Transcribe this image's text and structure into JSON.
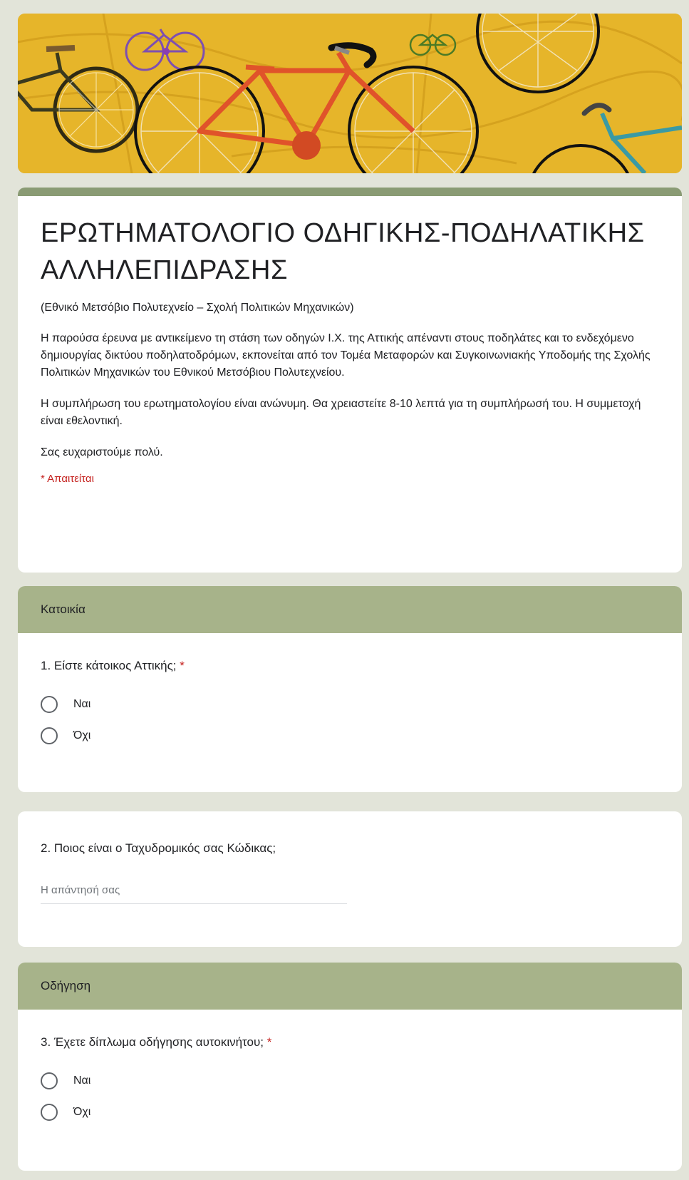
{
  "form": {
    "title": "ΕΡΩΤΗΜΑΤΟΛΟΓΙΟ ΟΔΗΓΙΚΗΣ-ΠΟΔΗΛΑΤΙΚΗΣ ΑΛΛΗΛΕΠΙΔΡΑΣΗΣ",
    "subtitle": "(Εθνικό Μετσόβιο Πολυτεχνείο – Σχολή Πολιτικών Μηχανικών)",
    "paragraph_1": "Η παρούσα έρευνα με αντικείμενο τη στάση των οδηγών Ι.Χ. της Αττικής απέναντι στους ποδηλάτες και το ενδεχόμενο δημιουργίας δικτύου ποδηλατοδρόμων, εκπονείται από τον Τομέα Μεταφορών και Συγκοινωνιακής Υποδομής της Σχολής Πολιτικών Μηχανικών του Εθνικού Μετσόβιου Πολυτεχνείου.",
    "paragraph_2": "Η συμπλήρωση του ερωτηματολογίου είναι ανώνυμη. Θα χρειαστείτε 8-10 λεπτά για τη συμπλήρωσή του. Η συμμετοχή είναι εθελοντική.",
    "paragraph_3": "Σας ευχαριστούμε πολύ.",
    "required_note": "* Απαιτείται"
  },
  "sections": [
    {
      "header": "Κατοικία",
      "question": {
        "text": "1. Είστε κάτοικος Αττικής;",
        "required_mark": "*",
        "options": [
          "Ναι",
          "Όχι"
        ]
      }
    },
    {
      "header": "Οδήγηση",
      "question": {
        "text": "3. Έχετε δίπλωμα οδήγησης αυτοκινήτου;",
        "required_mark": "*",
        "options": [
          "Ναι",
          "Όχι"
        ]
      }
    }
  ],
  "question_2": {
    "text": "2. Ποιος είναι ο Ταχυδρομικός σας Κώδικας;",
    "placeholder": "Η απάντησή σας",
    "value": ""
  },
  "theme": {
    "background": "#e2e4d9",
    "title_bar": "#8a9b74",
    "section_header": "#a7b38a",
    "required": "#c5221f"
  },
  "banner": {
    "illustration": "bicycles-illustration",
    "background_color": "#e6b52a"
  }
}
